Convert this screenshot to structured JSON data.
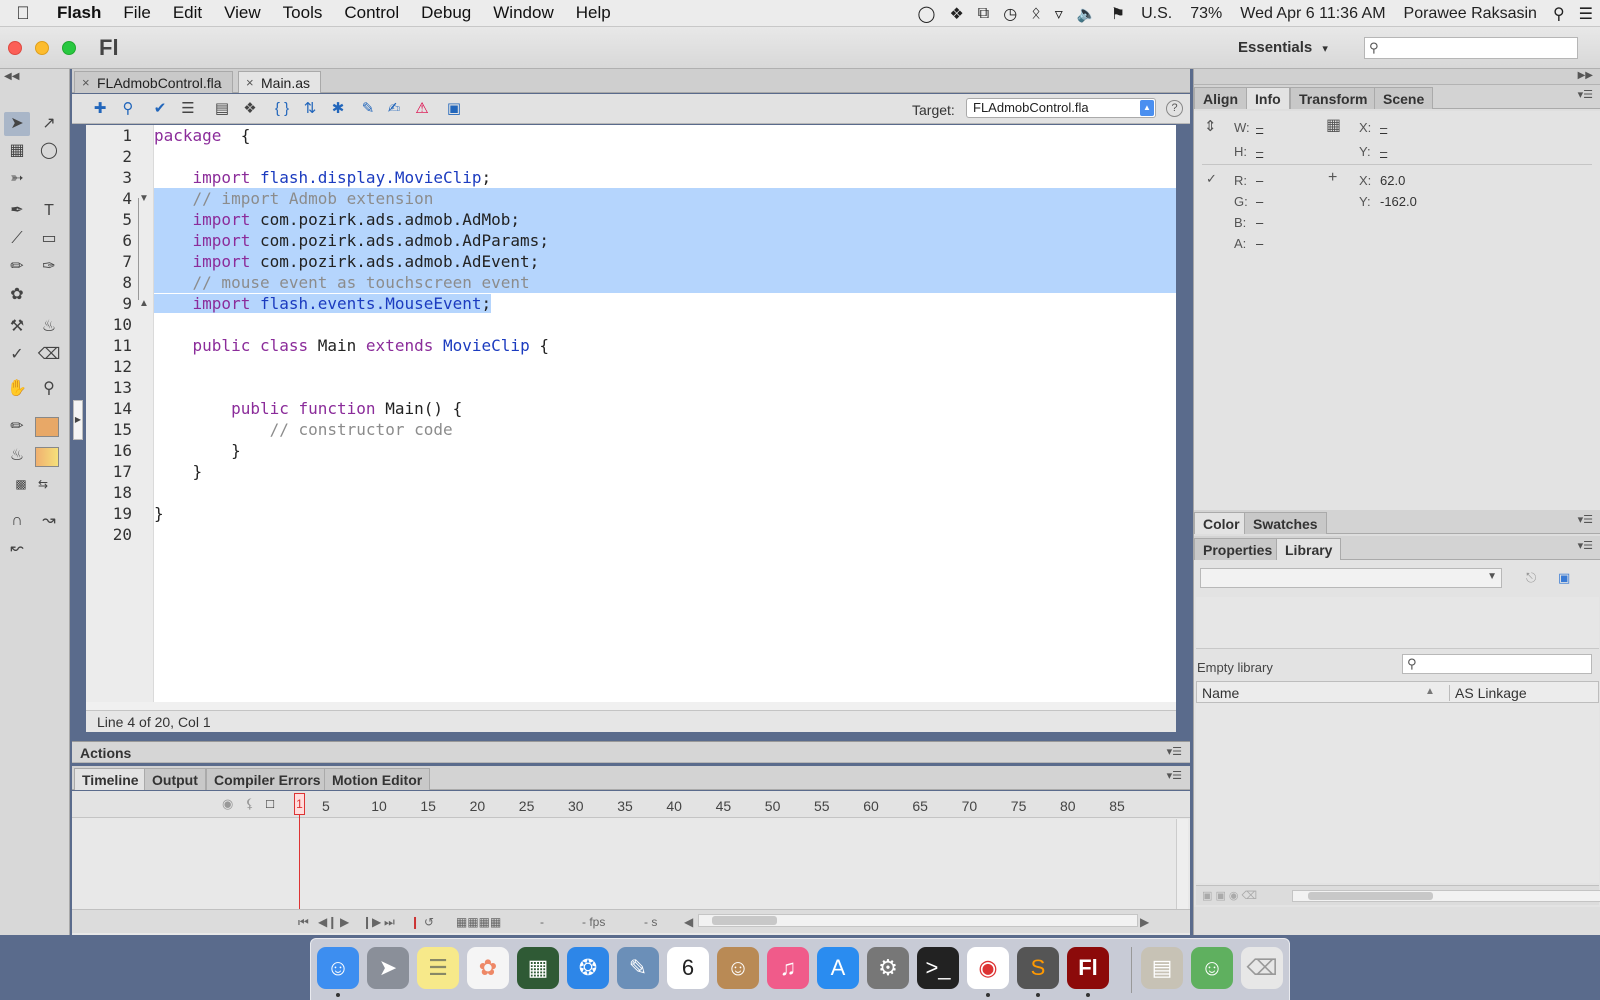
{
  "menubar": {
    "apple": "",
    "items": [
      "Flash",
      "Edit",
      "View",
      "Tools",
      "Control",
      "Debug",
      "Window",
      "Help"
    ],
    "edit_items": [
      "File"
    ],
    "status": {
      "input_source": "U.S.",
      "battery": "73%",
      "datetime": "Wed Apr 6  11:36 AM",
      "user": "Porawee Raksasin"
    }
  },
  "window": {
    "app_logo": "Fl",
    "workspace": "Essentials",
    "workspace_arrow": "▾"
  },
  "doc_tabs": [
    {
      "label": "FLAdmobControl.fla",
      "close": "×"
    },
    {
      "label": "Main.as",
      "close": "×"
    }
  ],
  "editor": {
    "target_label": "Target:",
    "target_value": "FLAdmobControl.fla",
    "help": "?",
    "status": "Line 4 of 20, Col 1",
    "line_numbers": [
      "1",
      "2",
      "3",
      "4",
      "5",
      "6",
      "7",
      "8",
      "9",
      "10",
      "11",
      "12",
      "13",
      "14",
      "15",
      "16",
      "17",
      "18",
      "19",
      "20"
    ]
  },
  "actions_panel": {
    "title": "Actions"
  },
  "timeline": {
    "tabs": [
      "Timeline",
      "Output",
      "Compiler Errors",
      "Motion Editor"
    ],
    "playhead": "1",
    "frame_ticks": [
      "5",
      "10",
      "15",
      "20",
      "25",
      "30",
      "35",
      "40",
      "45",
      "50",
      "55",
      "60",
      "65",
      "70",
      "75",
      "80",
      "85"
    ],
    "fps": "- fps",
    "time": "- s",
    "frame": "-"
  },
  "info_panel": {
    "tabs": [
      "Align",
      "Info",
      "Transform",
      "Scene"
    ],
    "w_label": "W:",
    "w_val": "–",
    "h_label": "H:",
    "h_val": "–",
    "x_label": "X:",
    "x_val": "–",
    "y_label": "Y:",
    "y_val": "–",
    "r_label": "R:",
    "r_val": "–",
    "g_label": "G:",
    "g_val": "–",
    "b_label": "B:",
    "b_val": "–",
    "a_label": "A:",
    "a_val": "–",
    "cx_label": "X:",
    "cx_val": "62.0",
    "cy_label": "Y:",
    "cy_val": "-162.0"
  },
  "color_panel": {
    "tabs": [
      "Color",
      "Swatches"
    ]
  },
  "library_panel": {
    "tabs": [
      "Properties",
      "Library"
    ],
    "empty_text": "Empty library",
    "col_name": "Name",
    "col_linkage": "AS Linkage"
  },
  "colors": {
    "selection": "#b5d5fd",
    "keyword": "#8b2c9a",
    "class": "#1b3bbf",
    "comment": "#8c8c8c"
  }
}
